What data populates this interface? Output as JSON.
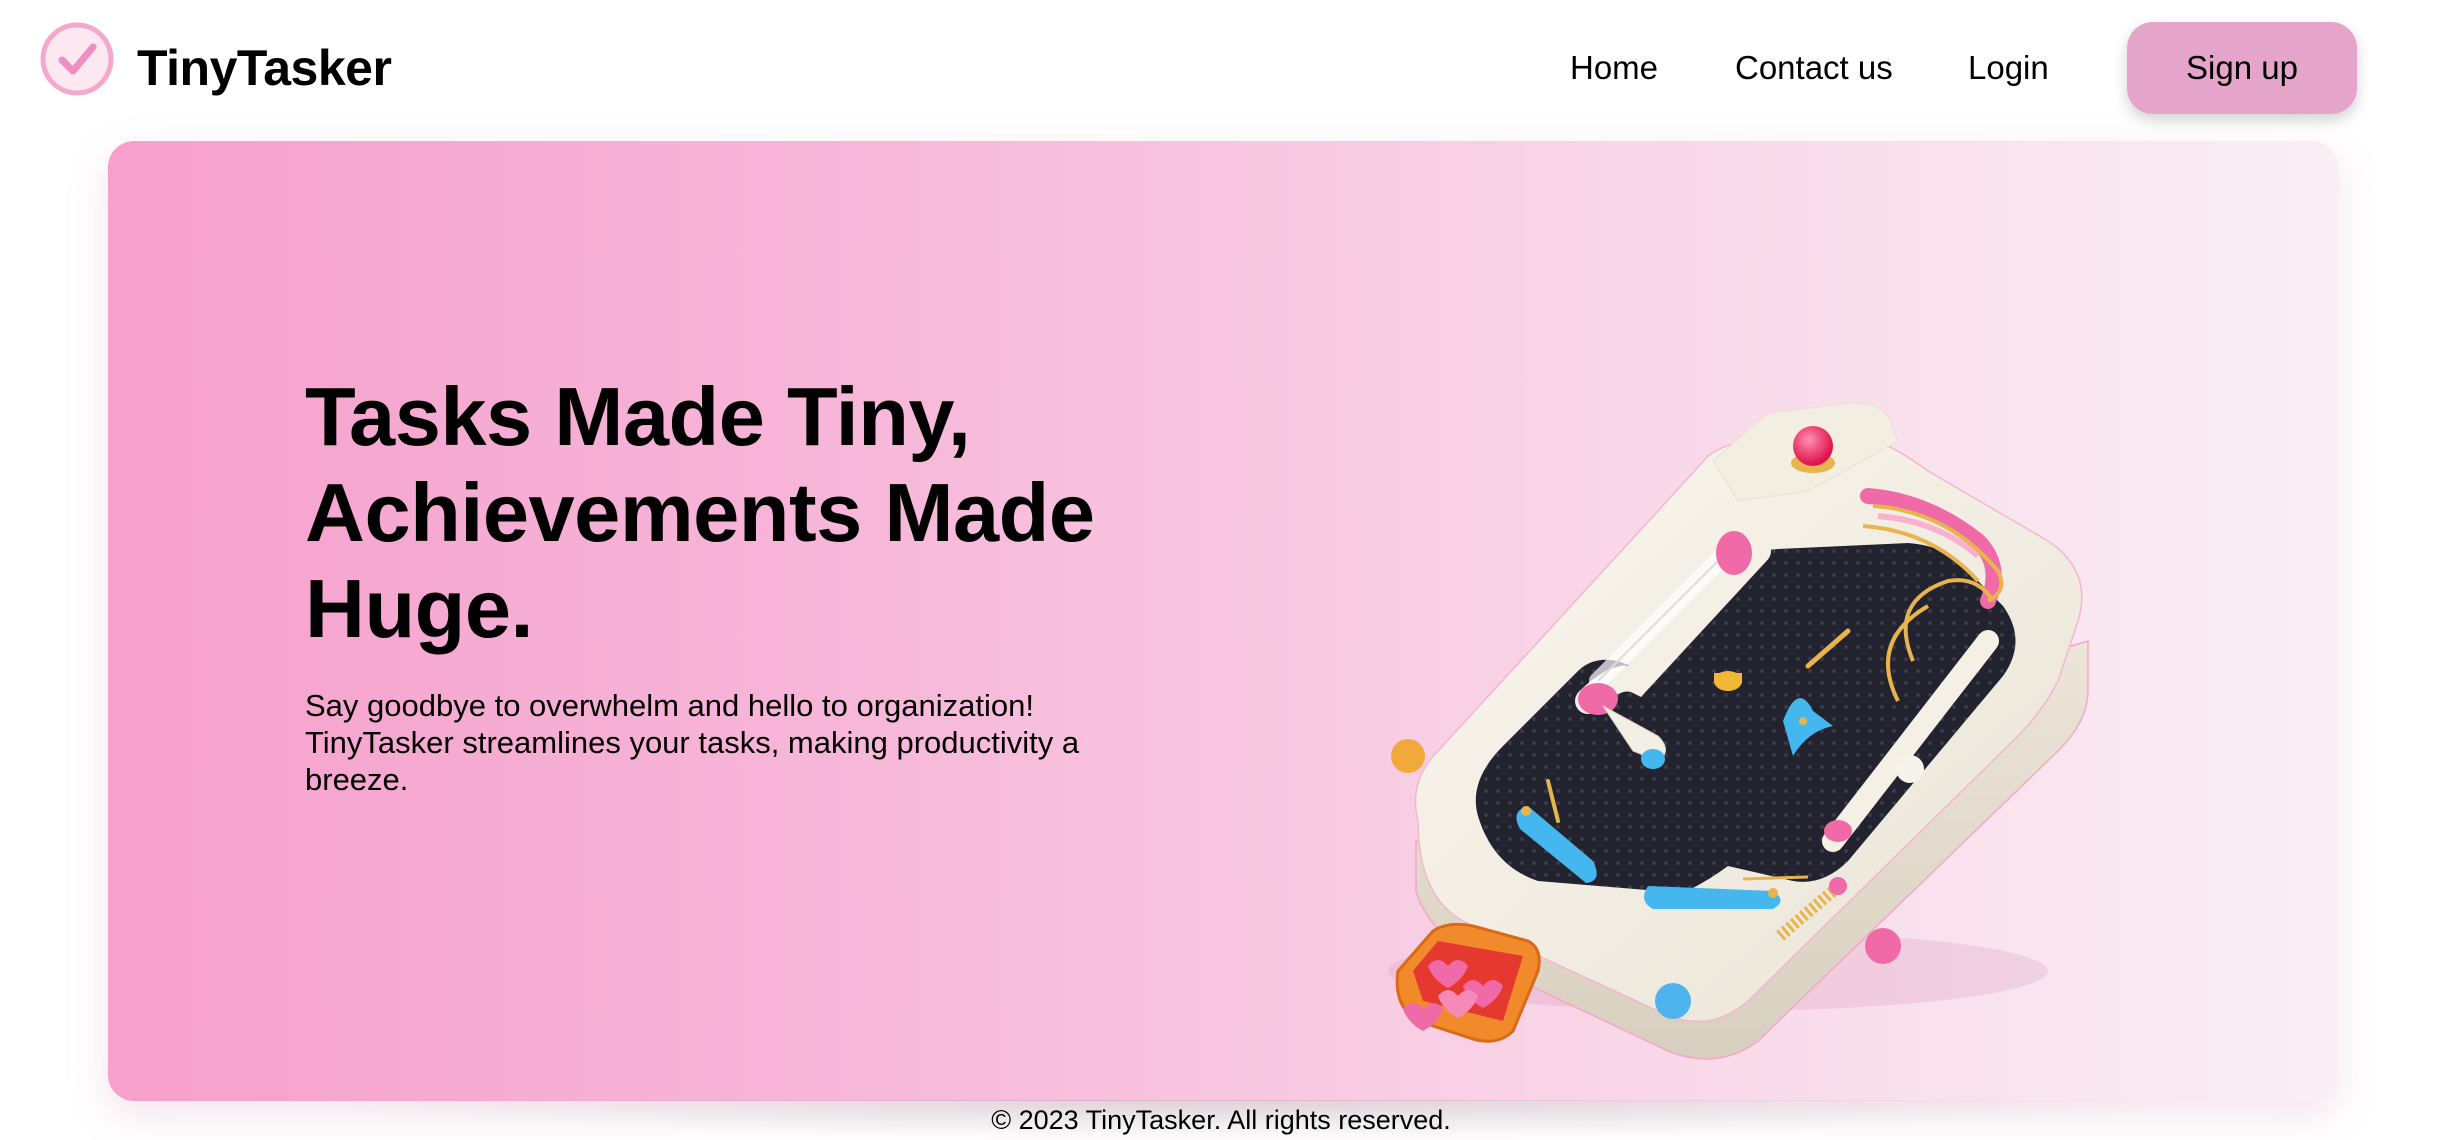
{
  "header": {
    "brand": "TinyTasker",
    "nav": {
      "home": "Home",
      "contact": "Contact us",
      "login": "Login",
      "signup": "Sign up"
    },
    "icons": {
      "logo": "check-circle-icon"
    }
  },
  "hero": {
    "headline": "Tasks Made Tiny, Achievements Made Huge.",
    "subtext": "Say goodbye to overwhelm and hello to organization! TinyTasker streamlines your tasks, making productivity a breeze.",
    "illustration": "pinball-machine-illustration"
  },
  "footer": {
    "copyright": "© 2023 TinyTasker. All rights reserved."
  },
  "colors": {
    "accent": "#f7a6cf",
    "button": "#e5a4c9",
    "hero_gradient_start": "#f6a0cb",
    "hero_gradient_end": "#f9eff4"
  }
}
